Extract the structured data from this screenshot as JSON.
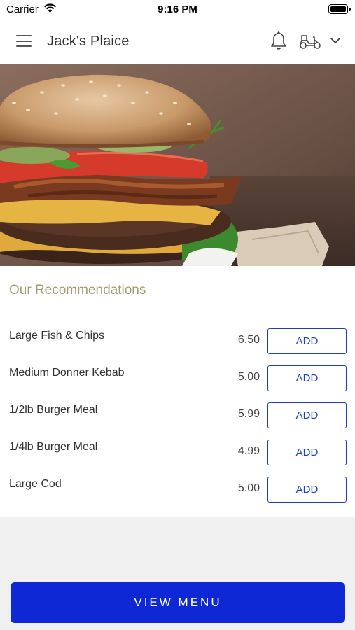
{
  "status_bar": {
    "carrier": "Carrier",
    "time": "9:16 PM"
  },
  "header": {
    "title": "Jack's Plaice",
    "icons": [
      "menu-icon",
      "bell-icon",
      "scooter-icon",
      "chevron-down-icon"
    ]
  },
  "hero": {
    "icon": "burger-photo"
  },
  "recommendations": {
    "title": "Our Recommendations",
    "items": [
      {
        "name": "Large Fish & Chips",
        "price": "6.50",
        "action": "ADD"
      },
      {
        "name": "Medium Donner Kebab",
        "price": "5.00",
        "action": "ADD"
      },
      {
        "name": "1/2lb Burger Meal",
        "price": "5.99",
        "action": "ADD"
      },
      {
        "name": "1/4lb Burger Meal",
        "price": "4.99",
        "action": "ADD"
      },
      {
        "name": "Large Cod",
        "price": "5.00",
        "action": "ADD"
      }
    ]
  },
  "footer": {
    "view_menu_label": "VIEW MENU"
  },
  "colors": {
    "accent": "#1e3fbf",
    "primary_button": "#0f28d6",
    "section_title": "#a89b6e"
  }
}
